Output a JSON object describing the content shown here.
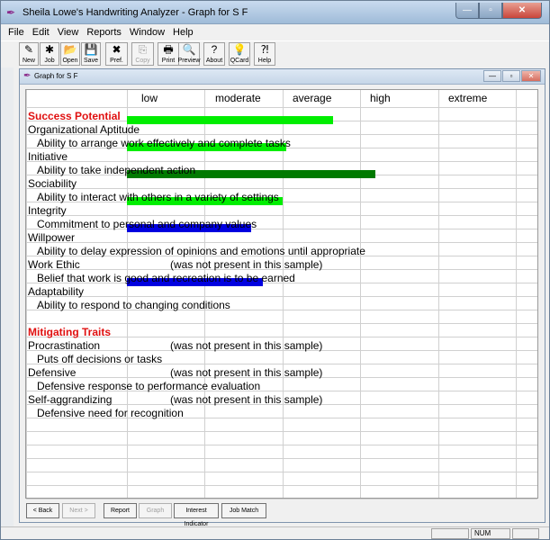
{
  "window": {
    "title": "Sheila Lowe's Handwriting Analyzer - Graph for S F",
    "min": "—",
    "max": "▫",
    "close": "✕"
  },
  "menu": [
    "File",
    "Edit",
    "View",
    "Reports",
    "Window",
    "Help"
  ],
  "toolbar": [
    {
      "label": "New",
      "icon": "new-icon",
      "glyph": "✎",
      "enabled": true
    },
    {
      "label": "Job",
      "icon": "job-icon",
      "glyph": "✱",
      "enabled": true
    },
    {
      "label": "Open",
      "icon": "open-folder-icon",
      "glyph": "📂",
      "enabled": true
    },
    {
      "label": "Save",
      "icon": "save-disk-icon",
      "glyph": "💾",
      "enabled": true
    },
    {
      "label": "Pref.",
      "icon": "preferences-icon",
      "glyph": "✖",
      "enabled": true
    },
    {
      "label": "Copy",
      "icon": "copy-icon",
      "glyph": "⎘",
      "enabled": false
    },
    {
      "label": "Print",
      "icon": "print-icon",
      "glyph": "🖶",
      "enabled": true
    },
    {
      "label": "Preview",
      "icon": "preview-icon",
      "glyph": "🔍",
      "enabled": true
    },
    {
      "label": "About",
      "icon": "about-question-icon",
      "glyph": "?",
      "enabled": true
    },
    {
      "label": "QCard",
      "icon": "qcard-bulb-icon",
      "glyph": "💡",
      "enabled": true
    },
    {
      "label": "Help",
      "icon": "help-pointer-icon",
      "glyph": "⁈",
      "enabled": true
    }
  ],
  "child": {
    "title": "Graph for S F",
    "min": "—",
    "max": "▫",
    "close": "✕"
  },
  "graph": {
    "columns": [
      "low",
      "moderate",
      "average",
      "high",
      "extreme"
    ],
    "not_present": "(was not present in this sample)",
    "sections": [
      {
        "name": "Success Potential",
        "traits": [
          {
            "name": "Organizational Aptitude",
            "desc": "Ability to arrange work effectively and complete tasks",
            "level": 0.53,
            "color": "#00ee00"
          },
          {
            "name": "Initiative",
            "desc": "Ability to take independent action",
            "level": 0.41,
            "color": "#00ee00"
          },
          {
            "name": "Sociability",
            "desc": "Ability to interact with others in a variety of settings",
            "level": 0.64,
            "color": "#007a00"
          },
          {
            "name": "Integrity",
            "desc": "Commitment to personal and company values",
            "level": 0.4,
            "color": "#00ee00"
          },
          {
            "name": "Willpower",
            "desc": "Ability to delay expression of opinions and emotions until appropriate",
            "level": 0.32,
            "color": "#0000e0"
          },
          {
            "name": "Work Ethic",
            "desc": "Belief that work is good and recreation is to be earned",
            "level": null,
            "color": ""
          },
          {
            "name": "Adaptability",
            "desc": "Ability to respond to changing conditions",
            "level": 0.35,
            "color": "#0000e0"
          }
        ]
      },
      {
        "name": "Mitigating Traits",
        "traits": [
          {
            "name": "Procrastination",
            "desc": "Puts off decisions or tasks",
            "level": null,
            "color": ""
          },
          {
            "name": "Defensive",
            "desc": "Defensive response to performance evaluation",
            "level": null,
            "color": ""
          },
          {
            "name": "Self-aggrandizing",
            "desc": "Defensive need for recognition",
            "level": null,
            "color": ""
          }
        ]
      }
    ]
  },
  "nav": [
    {
      "label": "< Back",
      "enabled": true
    },
    {
      "label": "Next >",
      "enabled": false
    },
    {
      "label": "Report",
      "enabled": true
    },
    {
      "label": "Graph",
      "enabled": false
    },
    {
      "label": "Interest Indicator",
      "enabled": true
    },
    {
      "label": "Job Match",
      "enabled": true
    }
  ],
  "status": {
    "num": "NUM"
  }
}
